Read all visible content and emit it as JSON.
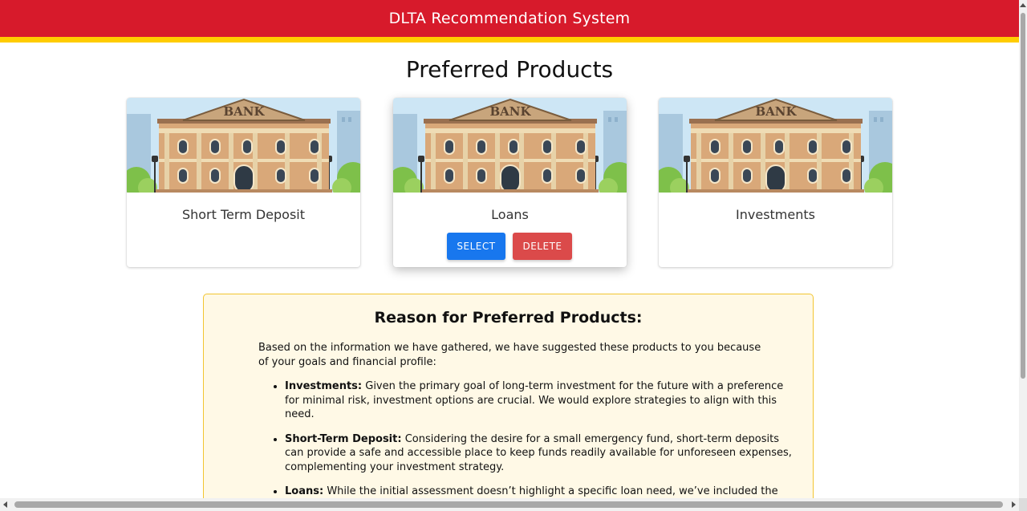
{
  "header": {
    "title": "DLTA Recommendation System"
  },
  "page": {
    "title": "Preferred Products"
  },
  "products": [
    {
      "label": "Short Term Deposit",
      "image_alt": "bank-building"
    },
    {
      "label": "Loans",
      "image_alt": "bank-building",
      "select_label": "SELECT",
      "delete_label": "DELETE"
    },
    {
      "label": "Investments",
      "image_alt": "bank-building"
    }
  ],
  "bank_sign": "BANK",
  "reason": {
    "title": "Reason for Preferred Products:",
    "intro": "Based on the information we have gathered, we have suggested these products to you because of your goals and financial profile:",
    "items": [
      {
        "term": "Investments:",
        "text": " Given the primary goal of long-term investment for the future with a preference for minimal risk, investment options are crucial. We would explore strategies to align with this need."
      },
      {
        "term": "Short-Term Deposit:",
        "text": " Considering the desire for a small emergency fund, short-term deposits can provide a safe and accessible place to keep funds readily available for unforeseen expenses, complementing your investment strategy."
      },
      {
        "term": "Loans:",
        "text": " While the initial assessment doesn’t highlight a specific loan need, we’ve included the"
      }
    ]
  },
  "colors": {
    "header": "#d71a2b",
    "stripe": "#ffcc00",
    "select_button": "#1877ee",
    "delete_button": "#db4a4a",
    "reason_bg": "#fff9e6",
    "reason_border": "#f2c531"
  }
}
